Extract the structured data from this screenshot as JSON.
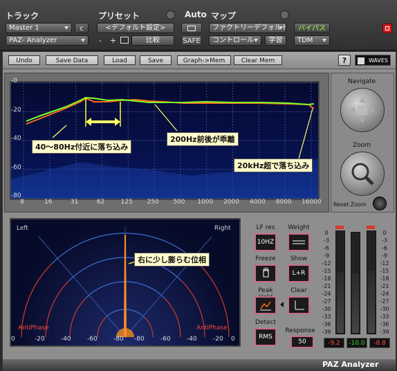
{
  "header": {
    "track_label": "トラック",
    "preset_label": "プリセット",
    "auto_label": "Auto",
    "map_label": "マップ",
    "track_name": "Master 1",
    "track_channel": "c",
    "plugin_name": "PAZ- Analyzer",
    "preset_value": "<デフォルト設定>",
    "minus": "-",
    "plus": "+",
    "compare": "比較",
    "safe": "SAFE",
    "map_value": "ファクトリーデフォルト",
    "control": "コントロール",
    "learn": "学習",
    "bypass": "バイパス",
    "tdm": "TDM"
  },
  "toolbar": {
    "undo": "Undo",
    "save_data": "Save Data",
    "load": "Load",
    "save": "Save",
    "graph_mem": "Graph->Mem",
    "clear_mem": "Clear Mem",
    "help": "?",
    "waves": "WAVES"
  },
  "spectrum": {
    "y_ticks": [
      "-0",
      "-20",
      "-40",
      "-60",
      "-80"
    ],
    "x_ticks": [
      "8",
      "16",
      "31",
      "62",
      "125",
      "250",
      "500",
      "1000",
      "2000",
      "4000",
      "8000",
      "16000"
    ],
    "callout_low": "40〜80Hz付近に落ち込み",
    "callout_mid": "200Hz前後が乖離",
    "callout_high": "20kHz超で落ち込み"
  },
  "navigate": {
    "title": "Navigate",
    "clear_label": "Clear",
    "reset_zoom": "Reset Zoom",
    "zoom_label": "Zoom"
  },
  "position": {
    "left": "Left",
    "right": "Right",
    "antiphase_left": "AntiPhase",
    "antiphase_right": "AntiPhase",
    "callout": "右に少し膨らむ位相",
    "x_ticks": [
      "0",
      "-20",
      "-40",
      "-60",
      "-80",
      "-80",
      "-60",
      "-40",
      "-20",
      "0"
    ]
  },
  "controls": {
    "lf_res": "LF res",
    "lf_res_value": "10HZ",
    "weight": "Weight",
    "freeze": "Freeze",
    "show": "Show",
    "show_value": "L+R",
    "peak_hold": "Peak Hold",
    "clear": "Clear",
    "detect": "Detect",
    "detect_value": "RMS",
    "response": "Response",
    "response_value": "50"
  },
  "meters": {
    "scale": [
      "0",
      "-3",
      "-6",
      "-9",
      "-12",
      "-15",
      "-18",
      "-21",
      "-24",
      "-27",
      "-30",
      "-33",
      "-36",
      "-39"
    ],
    "left_value": "-9.2",
    "center_value": "-10.0",
    "right_value": "-8.8"
  },
  "footer": {
    "name": "PAZ Analyzer"
  },
  "colors": {
    "accent_green": "#7cff2a",
    "curve_orange": "#ff6a1a",
    "meter_red": "#ff3b2a",
    "meter_green": "#33dd33"
  }
}
